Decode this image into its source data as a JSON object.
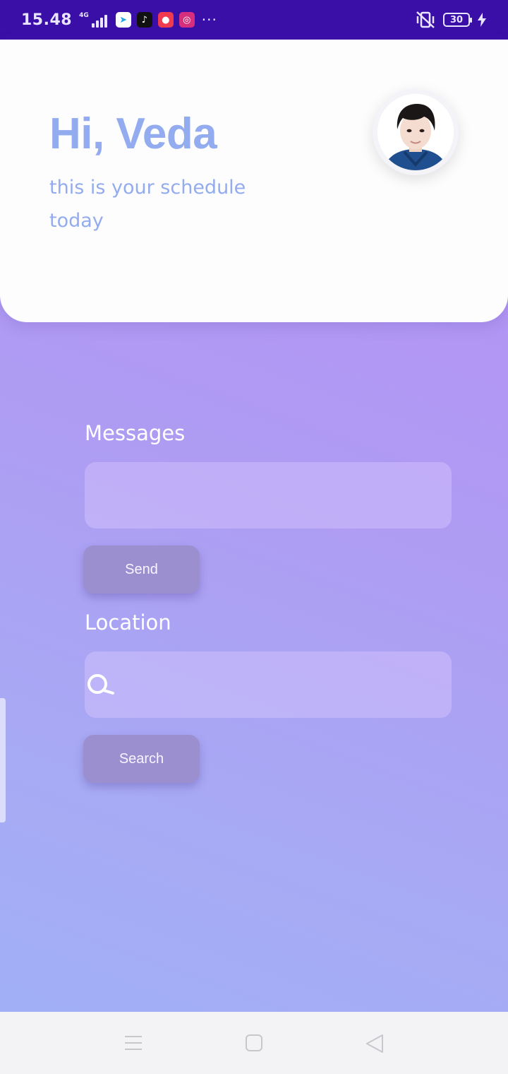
{
  "status_bar": {
    "time": "15.48",
    "network": "4G",
    "battery": "30",
    "apps": [
      {
        "name": "telegram-icon",
        "color": "#2aa3df",
        "glyph": "➤"
      },
      {
        "name": "tiktok-icon",
        "color": "#111111",
        "glyph": "♪"
      },
      {
        "name": "screen-recorder-icon",
        "color": "#f03a4f",
        "glyph": "●"
      },
      {
        "name": "instagram-icon",
        "color": "#d62f7d",
        "glyph": "◎"
      }
    ],
    "more": "···"
  },
  "header": {
    "greeting": "Hi, Veda",
    "subtitle": "this is your schedule today",
    "avatar_icon": "profile-photo"
  },
  "messages": {
    "label": "Messages",
    "input_value": "",
    "send_label": "Send"
  },
  "location": {
    "label": "Location",
    "input_value": "",
    "search_icon": "search-icon",
    "search_label": "Search"
  },
  "nav": {
    "menu_icon": "menu-icon",
    "home_icon": "home-icon",
    "back_icon": "back-icon"
  },
  "colors": {
    "status_bar": "#3a0fa8",
    "heading": "#93acef",
    "button": "#9b8fd0"
  }
}
